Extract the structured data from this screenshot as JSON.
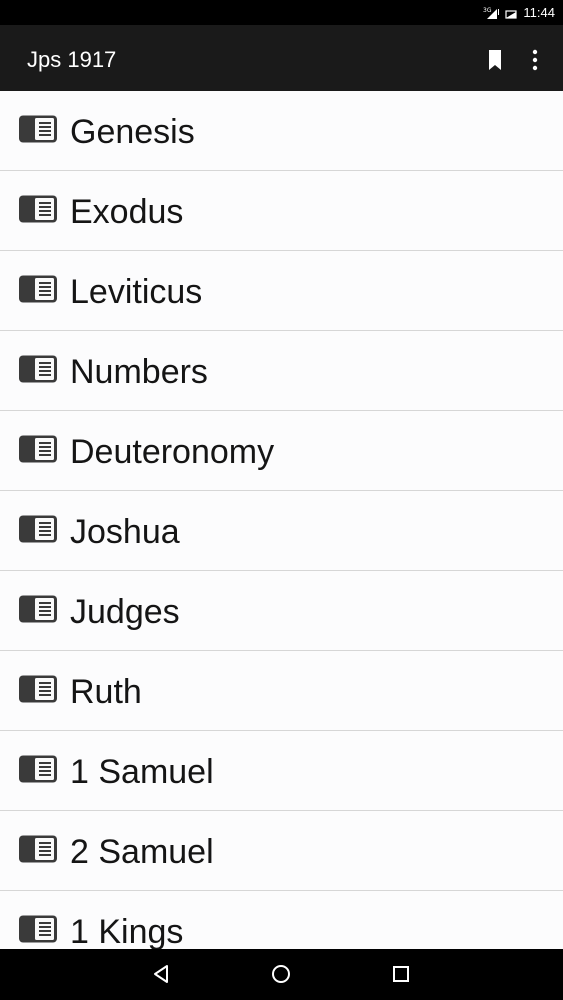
{
  "status_bar": {
    "time": "11:44",
    "network": "3G"
  },
  "app_bar": {
    "title": "Jps 1917"
  },
  "books": [
    "Genesis",
    "Exodus",
    "Leviticus",
    "Numbers",
    "Deuteronomy",
    "Joshua",
    "Judges",
    "Ruth",
    "1 Samuel",
    "2 Samuel",
    "1 Kings"
  ],
  "icons": {
    "list_item": "book-icon",
    "bookmark": "bookmark-icon",
    "menu": "more-vert-icon"
  }
}
